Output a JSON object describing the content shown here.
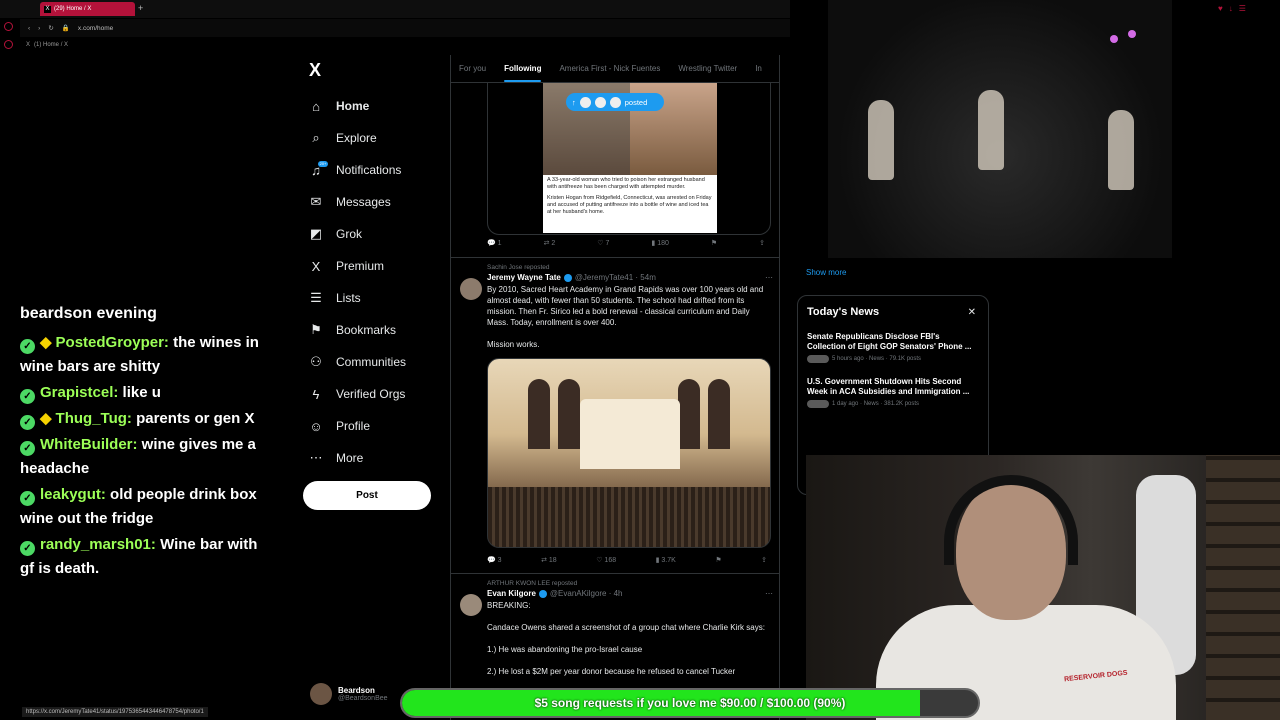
{
  "browser": {
    "tab_title": "(29) Home / X",
    "tab_add": "+",
    "url": "x.com/home",
    "bookmark": "(1) Home / X",
    "status_url": "https://x.com/JeremyTate41/status/1975365443446478754/photo/1"
  },
  "chat": {
    "header": "beardson evening",
    "messages": [
      {
        "user": "PostedGroyper:",
        "text": "the wines in wine bars are shitty",
        "diamond": true
      },
      {
        "user": "Grapistcel:",
        "text": "like u",
        "diamond": false
      },
      {
        "user": "Thug_Tug:",
        "text": "parents or gen X",
        "diamond": true
      },
      {
        "user": "WhiteBuilder:",
        "text": "wine gives me a headache",
        "diamond": false
      },
      {
        "user": "leakygut:",
        "text": "old people drink box wine out the fridge",
        "diamond": false
      },
      {
        "user": "randy_marsh01:",
        "text": "Wine bar with gf is death.",
        "diamond": false
      }
    ]
  },
  "nav": {
    "logo": "X",
    "items": [
      {
        "label": "Home",
        "icon": "⌂",
        "name": "home"
      },
      {
        "label": "Explore",
        "icon": "⌕",
        "name": "explore"
      },
      {
        "label": "Notifications",
        "icon": "♫",
        "name": "notifications",
        "badge": "20+"
      },
      {
        "label": "Messages",
        "icon": "✉",
        "name": "messages"
      },
      {
        "label": "Grok",
        "icon": "◩",
        "name": "grok"
      },
      {
        "label": "Premium",
        "icon": "X",
        "name": "premium"
      },
      {
        "label": "Lists",
        "icon": "☰",
        "name": "lists"
      },
      {
        "label": "Bookmarks",
        "icon": "⚑",
        "name": "bookmarks"
      },
      {
        "label": "Communities",
        "icon": "⚇",
        "name": "communities"
      },
      {
        "label": "Verified Orgs",
        "icon": "ϟ",
        "name": "verified-orgs"
      },
      {
        "label": "Profile",
        "icon": "☺",
        "name": "profile"
      },
      {
        "label": "More",
        "icon": "⋯",
        "name": "more"
      }
    ],
    "post_button": "Post",
    "account_name": "Beardson",
    "account_handle": "@BeardsonBee"
  },
  "feed": {
    "tabs": [
      "For you",
      "Following",
      "America First - Nick Fuentes",
      "Wrestling Twitter",
      "In"
    ],
    "active_tab": "Following",
    "posted_pill": "posted",
    "post1": {
      "article_lines": "A 33-year-old woman who tried to poison her estranged husband with antifreeze has been charged with attempted murder.",
      "article_lines2": "Kristen Hogan from Ridgefield, Connecticut, was arrested on Friday and accused of putting antifreeze into a bottle of wine and iced tea at her husband's home.",
      "replies": "1",
      "reposts": "2",
      "likes": "7",
      "views": "180"
    },
    "post2": {
      "reposted_by": "Sachin Jose reposted",
      "name": "Jeremy Wayne Tate",
      "handle": "@JeremyTate41 · 54m",
      "text": "By 2010, Sacred Heart Academy in Grand Rapids was over 100 years old and almost dead, with fewer than 50 students. The school had drifted from its mission. Then Fr. Sirico led a bold renewal - classical curriculum and Daily Mass. Today, enrollment is over 400.\n\nMission works.",
      "replies": "3",
      "reposts": "18",
      "likes": "168",
      "views": "3.7K"
    },
    "post3": {
      "reposted_by": "ARTHUR KWON LEE reposted",
      "name": "Evan Kilgore",
      "handle": "@EvanAKilgore · 4h",
      "text": "BREAKING:\n\nCandace Owens shared a screenshot of a group chat where Charlie Kirk says:\n\n1.) He was abandoning the pro-Israel cause\n\n2.) He lost a $2M per year donor because he refused to cancel Tucker"
    }
  },
  "right": {
    "show_more": "Show more",
    "news_title": "Today's News",
    "news_items": [
      {
        "headline": "Senate Republicans Disclose FBI's Collection of Eight GOP Senators' Phone ...",
        "meta": "5 hours ago · News · 79.1K posts"
      },
      {
        "headline": "U.S. Government Shutdown Hits Second Week in ACA Subsidies and Immigration ...",
        "meta": "1 day ago · News · 381.2K posts"
      }
    ]
  },
  "goal": {
    "label": "$5 song requests if you love me $90.00 / $100.00 (90%)",
    "progress": 0.9
  },
  "webcam": {
    "shirt_text": "RESERVOIR DOGS"
  },
  "colors": {
    "accent": "#1d9bf0",
    "goal_fill": "#22e51c",
    "tab_red": "#b3123a"
  }
}
